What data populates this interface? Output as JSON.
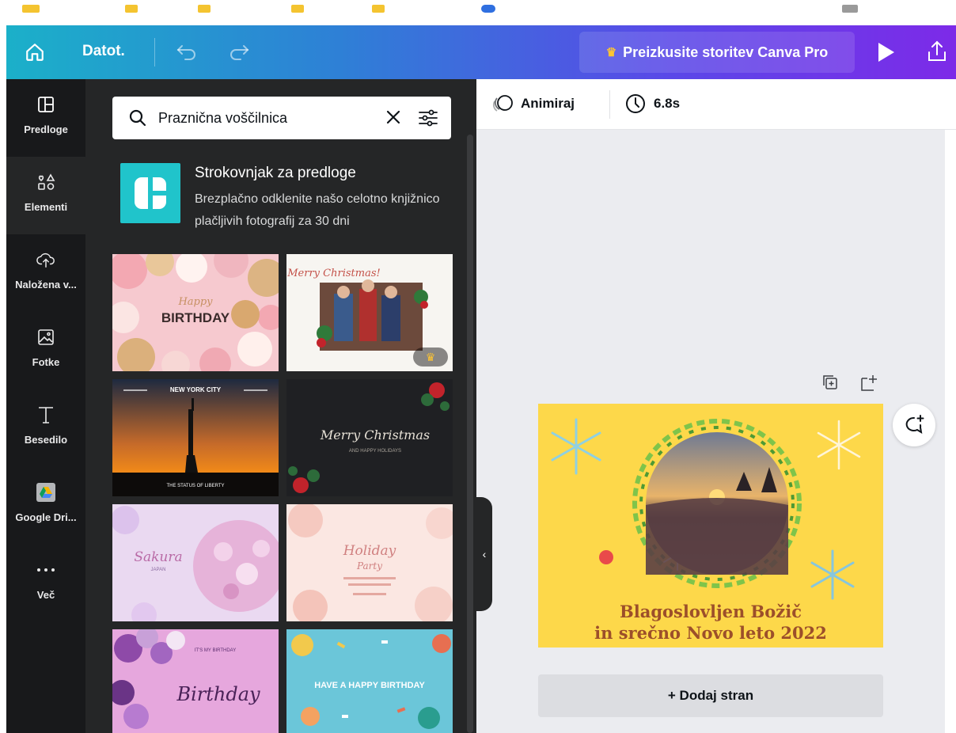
{
  "header": {
    "file_label": "Datot.",
    "pro_label": "Preizkusite storitev Canva Pro"
  },
  "rail": {
    "items": [
      {
        "label": "Predloge",
        "icon": "templates-icon"
      },
      {
        "label": "Elementi",
        "icon": "elements-icon"
      },
      {
        "label": "Naložena v...",
        "icon": "upload-icon"
      },
      {
        "label": "Fotke",
        "icon": "photos-icon"
      },
      {
        "label": "Besedilo",
        "icon": "text-icon"
      },
      {
        "label": "Google Dri...",
        "icon": "google-drive-icon"
      },
      {
        "label": "Več",
        "icon": "more-icon"
      }
    ]
  },
  "search": {
    "value": "Praznična voščilnica"
  },
  "promo": {
    "title": "Strokovnjak za predloge",
    "text": "Brezplačno odklenite našo celotno knjižnico plačljivih fotografij za 30 dni"
  },
  "templates": [
    {
      "name": "birthday-balloons",
      "texts": [
        "Happy",
        "BIRTHDAY"
      ]
    },
    {
      "name": "merry-christmas-photo",
      "texts": [
        "Merry Christmas!"
      ]
    },
    {
      "name": "new-york-city",
      "texts": [
        "NEW YORK CITY",
        "THE STATUS OF LIBERTY"
      ]
    },
    {
      "name": "merry-christmas-dark",
      "texts": [
        "Merry Christmas",
        "AND HAPPY HOLIDAYS"
      ]
    },
    {
      "name": "sakura",
      "texts": [
        "Sakura",
        "JAPAN"
      ]
    },
    {
      "name": "holiday-party",
      "texts": [
        "Holiday",
        "Party"
      ]
    },
    {
      "name": "birthday-purple",
      "texts": [
        "IT'S MY BIRTHDAY",
        "Birthday"
      ]
    },
    {
      "name": "have-a-happy-birthday",
      "texts": [
        "HAVE A HAPPY BIRTHDAY"
      ]
    }
  ],
  "editor": {
    "animate_label": "Animiraj",
    "duration": "6.8s",
    "card_line1": "Blagoslovljen Božič",
    "card_line2": "in srečno Novo leto 2022",
    "add_page_label": "+ Dodaj stran"
  },
  "colors": {
    "panel_bg": "#252627",
    "rail_bg": "#18191b",
    "accent_teal": "#20c4cb",
    "card_bg": "#fdd84a",
    "card_text": "#9c4f2a"
  }
}
